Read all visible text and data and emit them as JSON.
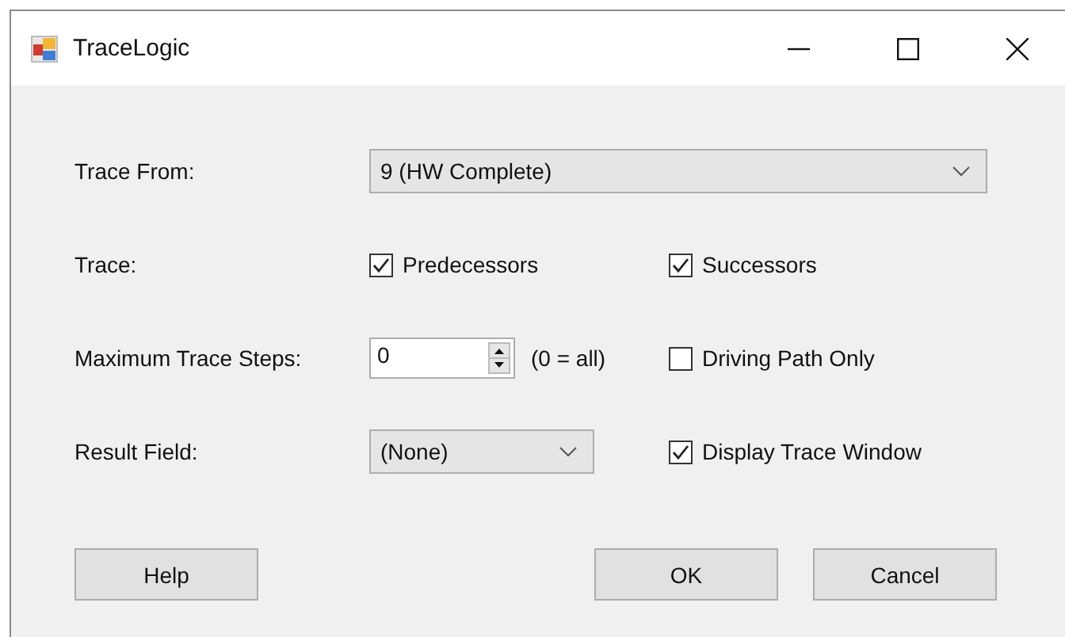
{
  "window": {
    "title": "TraceLogic"
  },
  "trace_from": {
    "label": "Trace From:",
    "value": "9 (HW Complete)"
  },
  "trace": {
    "label": "Trace:",
    "options": [
      {
        "label": "Predecessors",
        "checked": true
      },
      {
        "label": "Successors",
        "checked": true
      }
    ]
  },
  "max_steps": {
    "label": "Maximum Trace Steps:",
    "value": "0",
    "hint": "(0 = all)"
  },
  "driving_path_only": {
    "label": "Driving Path Only",
    "checked": false
  },
  "result_field": {
    "label": "Result Field:",
    "value": "(None)"
  },
  "display_trace_window": {
    "label": "Display Trace Window",
    "checked": true
  },
  "buttons": {
    "help": "Help",
    "ok": "OK",
    "cancel": "Cancel"
  }
}
